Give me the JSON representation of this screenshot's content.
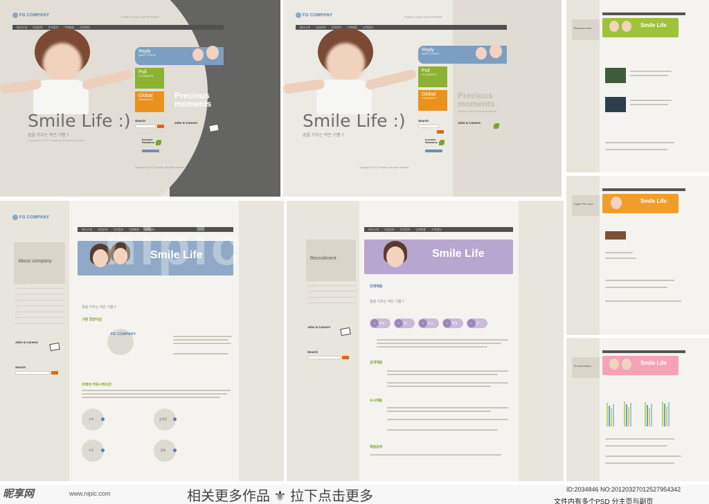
{
  "brand": {
    "company": "FG COMPANY"
  },
  "nav": {
    "items": [
      "회사소개",
      "사업분야",
      "투자정보",
      "인재채용",
      "고객센터"
    ]
  },
  "top_links": "HOME  LOGIN  JOIN  SITEMAP",
  "hero": {
    "title": "Smile Life :)",
    "subtitle": "꿈을 키우는 작은 기쁨 !!",
    "tagline": "Smile Life"
  },
  "boxes": {
    "reply": {
      "title": "Reply",
      "sub": "HAPPY CHECK"
    },
    "poll": {
      "title": "Poll",
      "sub": "FG WEBSITE"
    },
    "global": {
      "title": "Global",
      "sub": "COMMUNITY"
    }
  },
  "search": {
    "label": "Search"
  },
  "precious": {
    "line1": "Precious",
    "line2": "moments",
    "sub": "Discover the Precious Moments"
  },
  "jobs": {
    "label": "Jobs & Careers"
  },
  "investor": {
    "label_1": "Investor",
    "label_2": "Relations"
  },
  "footer": "Copyright (c) FG Company. All rights reserved.",
  "sub_pages": {
    "about": {
      "head": "About company",
      "section": "기본 경영이념",
      "section2": "미래의 커뮤니케이션"
    },
    "recruit": {
      "head": "Recruitment",
      "section": "인재채용",
      "section2": "공개채용",
      "section3": "수시채용",
      "section4": "채용문의"
    },
    "business": {
      "head": "Business area"
    },
    "cyber": {
      "head": "Cyber PR room"
    },
    "ir": {
      "head": "IR information"
    }
  },
  "steps": [
    "서류전형",
    "면접",
    "적성검사",
    "최종면접",
    "입사"
  ],
  "circles": [
    "고객",
    "임직원",
    "주주",
    "협력"
  ],
  "watermark": {
    "logo": "昵享网",
    "url": "www.nipic.com",
    "center": "相关更多作品  ⚜  拉下点击更多",
    "id": "ID:2034846 NO:20120327012527954342",
    "bottom": "文件内有多个PSD 分主页与副页"
  },
  "colors": {
    "reply": "#7a9fc3",
    "poll": "#8cb232",
    "global": "#e9921d",
    "nav": "#505050"
  }
}
